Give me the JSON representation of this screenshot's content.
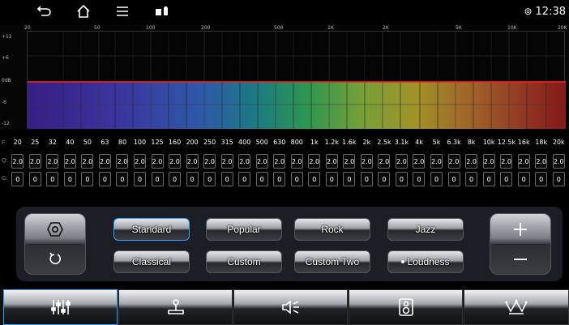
{
  "status_bar": {
    "time": "12:38",
    "icons": [
      "back-icon",
      "home-icon",
      "menu-icon",
      "usb-icon",
      "location-icon"
    ]
  },
  "eq_graph": {
    "freq_axis": [
      "20",
      "50",
      "100",
      "200",
      "500",
      "1K",
      "2K",
      "5K",
      "10K",
      "20K"
    ],
    "db_axis": [
      "+12",
      "+6",
      "0dB",
      "-6",
      "-12"
    ]
  },
  "bands": {
    "f_label": "F:",
    "q_label": "Q:",
    "g_label": "G:",
    "frequencies": [
      "20",
      "25",
      "32",
      "40",
      "50",
      "63",
      "80",
      "100",
      "125",
      "160",
      "200",
      "250",
      "315",
      "400",
      "500",
      "630",
      "800",
      "1k",
      "1.2k",
      "1.6k",
      "2k",
      "2.5k",
      "3.1k",
      "4k",
      "5k",
      "6.3k",
      "8k",
      "10k",
      "12.5k",
      "16k",
      "18k",
      "20k"
    ],
    "q_values": [
      "2.0",
      "2.0",
      "2.0",
      "2.0",
      "2.0",
      "2.0",
      "2.0",
      "2.0",
      "2.0",
      "2.0",
      "2.0",
      "2.0",
      "2.0",
      "2.0",
      "2.0",
      "2.0",
      "2.0",
      "2.0",
      "2.0",
      "2.0",
      "2.0",
      "2.0",
      "2.0",
      "2.0",
      "2.0",
      "2.0",
      "2.0",
      "2.0",
      "2.0",
      "2.0",
      "2.0",
      "2.0"
    ],
    "g_values": [
      "0",
      "0",
      "0",
      "0",
      "0",
      "0",
      "0",
      "0",
      "0",
      "0",
      "0",
      "0",
      "0",
      "0",
      "0",
      "0",
      "0",
      "0",
      "0",
      "0",
      "0",
      "0",
      "0",
      "0",
      "0",
      "0",
      "0",
      "0",
      "0",
      "0",
      "0",
      "0"
    ]
  },
  "presets": {
    "standard": "Standard",
    "popular": "Popular",
    "rock": "Rock",
    "jazz": "Jazz",
    "classical": "Classical",
    "custom": "Custom",
    "custom_two": "Custom Two",
    "loudness": "Loudness",
    "active": "Standard"
  },
  "tabs": [
    "equalizer-icon",
    "joystick-icon",
    "speaker-icon",
    "subwoofer-icon",
    "crown-icon"
  ],
  "colors": {
    "accent": "#2aa3ff",
    "eq_line": "#ff2222"
  }
}
